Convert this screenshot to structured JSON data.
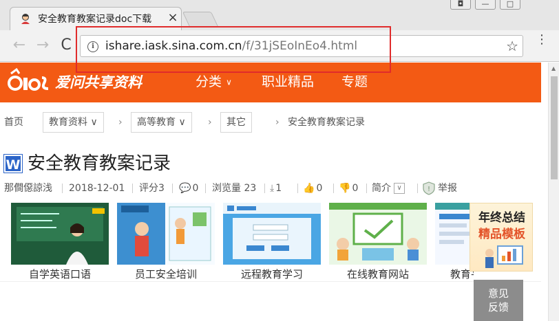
{
  "browser": {
    "tab": {
      "title": "安全教育教案记录doc下载",
      "close_glyph": "×",
      "favicon": "user-avatar-icon"
    },
    "window_controls": [
      {
        "name": "profile",
        "glyph": "◘"
      },
      {
        "name": "minimize",
        "glyph": "—"
      },
      {
        "name": "maximize",
        "glyph": "□"
      }
    ],
    "nav": {
      "back": "←",
      "forward": "→",
      "reload": "C"
    },
    "omnibox": {
      "host": "ishare.iask.sina.com.cn",
      "path": "/f/31jSEoInEo4.html",
      "info_glyph": "i",
      "star_glyph": "☆"
    },
    "menu_glyph": "⋮"
  },
  "site": {
    "logo_text": "爱问共享资料",
    "nav": [
      {
        "label": "分类",
        "chevron": "∨"
      },
      {
        "label": "职业精品"
      },
      {
        "label": "专题"
      }
    ],
    "breadcrumb": [
      {
        "label": "首页"
      },
      {
        "label": "教育资料",
        "chevron": "∨"
      },
      {
        "label": "高等教育",
        "chevron": "∨"
      },
      {
        "label": "其它"
      },
      {
        "label": "安全教育教案记录"
      }
    ],
    "crumb_separator": "›"
  },
  "document": {
    "type_glyph": "W",
    "title": "安全教育教案记录",
    "meta": {
      "author": "那僴僫諒浅",
      "date": "2018-12-01",
      "rating": "评分3",
      "comments": "0",
      "views": "浏览量 23",
      "downloads": "1",
      "likes": "0",
      "dislikes": "0",
      "intro": "简介",
      "report": "举报"
    }
  },
  "recommendations": [
    {
      "label": "自学英语口语"
    },
    {
      "label": "员工安全培训"
    },
    {
      "label": "远程教育学习"
    },
    {
      "label": "在线教育网站"
    },
    {
      "label": "教育平台公司"
    }
  ],
  "ad": {
    "line1": "年终总结",
    "line2": "精品模板"
  },
  "feedback": {
    "line1": "意见",
    "line2": "反馈"
  },
  "colors": {
    "brand": "#f35a14",
    "highlight": "#e02b2b",
    "word_blue": "#2b64c8"
  }
}
